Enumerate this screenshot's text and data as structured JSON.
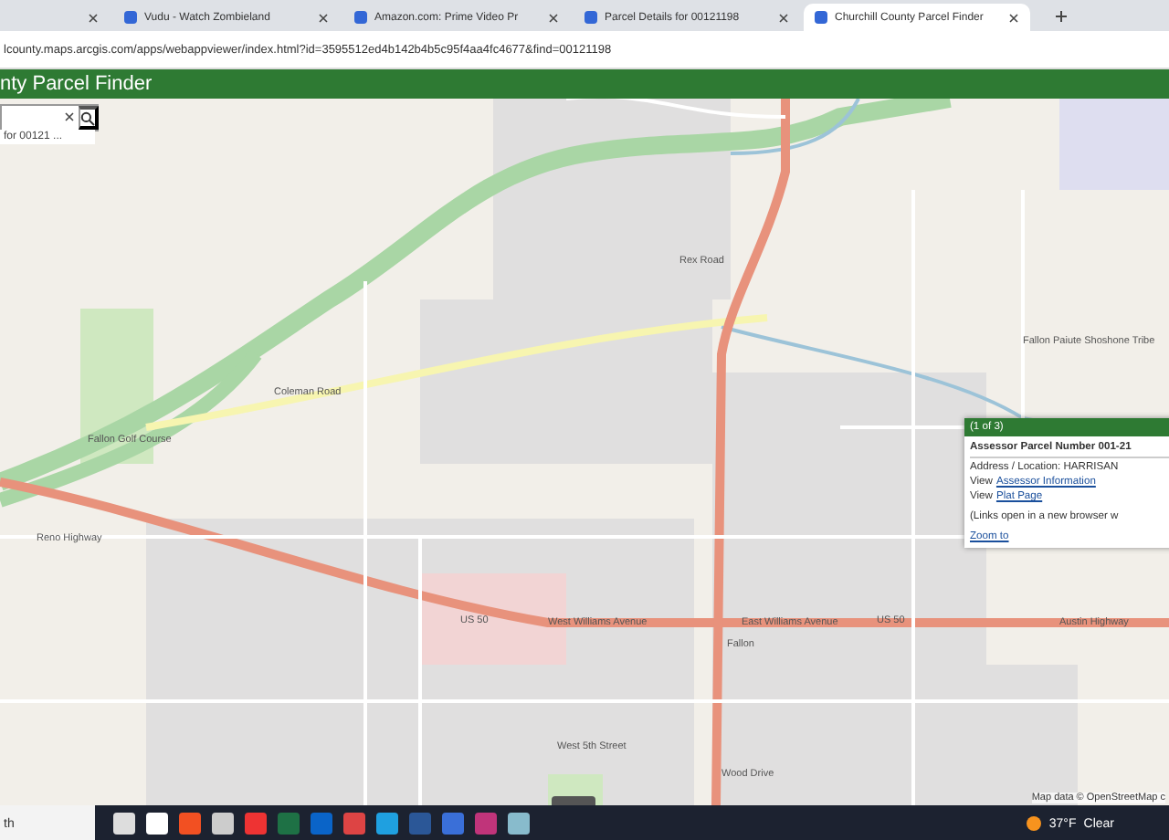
{
  "browser": {
    "tabs": [
      {
        "selected": false
      },
      {
        "title": "Vudu - Watch Zombieland",
        "selected": false
      },
      {
        "title": "Amazon.com: Prime Video Pr",
        "selected": false
      },
      {
        "title": "Parcel Details for 00121198",
        "selected": false
      },
      {
        "title": "Churchill County Parcel Finder",
        "selected": true
      }
    ],
    "url": "lcounty.maps.arcgis.com/apps/webappviewer/index.html?id=3595512ed4b142b4b5c95f4aa4fc4677&find=00121198"
  },
  "app_header": {
    "title": "nty Parcel Finder"
  },
  "search": {
    "suggestion": "for 00121 ..."
  },
  "map": {
    "labels": [
      "Rex Road",
      "Fallon Paiute Shoshone Tribe",
      "Coleman Road",
      "Fallon Golf Course",
      "Reno Highway",
      "US 50",
      "West Williams Avenue",
      "East Williams Avenue",
      "US 50",
      "Austin Highway",
      "Fallon",
      "West 5th Street",
      "Wood Drive"
    ],
    "attribution": "Map data © OpenStreetMap c"
  },
  "popup": {
    "counter": "(1 of 3)",
    "title": "Assessor Parcel Number 001-21",
    "address": "Address / Location: HARRISAN",
    "view_prefix_1": "View",
    "assessor_link": "Assessor Information",
    "view_prefix_2": "View",
    "plat_link": "Plat Page",
    "note": "(Links open in a new browser w",
    "zoom_link": "Zoom to"
  },
  "taskbar": {
    "search": "th",
    "weather": "37°F",
    "condition": "Clear"
  }
}
